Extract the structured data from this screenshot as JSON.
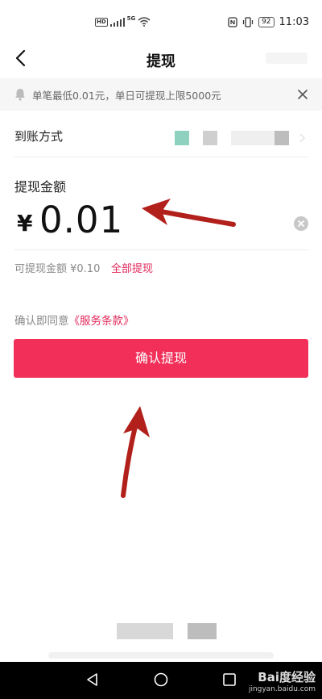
{
  "status_bar": {
    "hd": "HD",
    "network": "5G",
    "battery": "92",
    "time": "11:03"
  },
  "nav": {
    "title": "提现"
  },
  "notice": {
    "text": "单笔最低0.01元，单日可提现上限5000元"
  },
  "method": {
    "label": "到账方式"
  },
  "amount": {
    "label": "提现金额",
    "currency": "¥",
    "value": "0.01"
  },
  "available": {
    "text": "可提现金额 ¥0.10",
    "withdraw_all": "全部提现"
  },
  "agreement": {
    "prefix": "确认即同意",
    "link": "《服务条款》"
  },
  "confirm_button": {
    "label": "确认提现"
  },
  "watermark": {
    "logo": "Bai度经验",
    "url": "jingyan.baidu.com"
  },
  "colors": {
    "accent": "#f12f58",
    "link": "#e0285a",
    "arrow": "#b2201c"
  }
}
